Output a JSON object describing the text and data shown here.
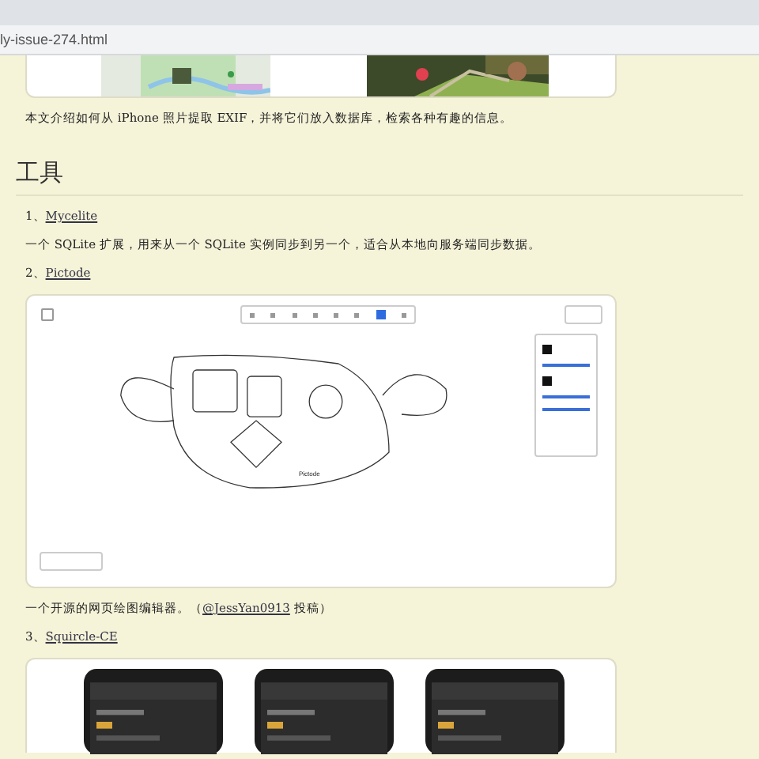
{
  "address_bar": {
    "url": "ly-issue-274.html"
  },
  "article": {
    "intro": "本文介绍如何从 iPhone 照片提取 EXIF，并将它们放入数据库，检索各种有趣的信息。",
    "heading": "工具",
    "items": [
      {
        "number": "1、",
        "link": "Mycelite",
        "description": "一个 SQLite 扩展，用来从一个 SQLite 实例同步到另一个，适合从本地向服务端同步数据。"
      },
      {
        "number": "2、",
        "link": "Pictode",
        "canvas_label": "Pictode",
        "description_before": "一个开源的网页绘图编辑器。（",
        "author": "@JessYan0913",
        "description_after": " 投稿）"
      },
      {
        "number": "3、",
        "link": "Squircle-CE"
      }
    ]
  }
}
